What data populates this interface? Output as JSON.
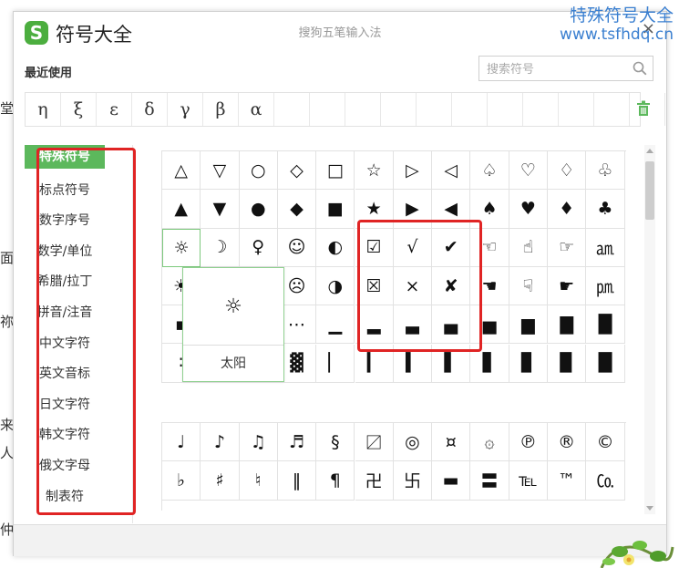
{
  "watermark": {
    "line1": "特殊符号大全",
    "line2": "www.tsfhdq.cn"
  },
  "background_chars": [
    "堂",
    "面",
    "祢",
    "来",
    "人",
    "仲"
  ],
  "window": {
    "logo": "S",
    "title": "符号大全",
    "subtitle": "搜狗五笔输入法",
    "close": "×"
  },
  "recent": {
    "label": "最近使用",
    "items": [
      "η",
      "ξ",
      "ε",
      "δ",
      "γ",
      "β",
      "α",
      "",
      "",
      "",
      "",
      "",
      "",
      "",
      "",
      "",
      "",
      ""
    ]
  },
  "search": {
    "placeholder": "搜索符号",
    "value": ""
  },
  "sidebar": {
    "items": [
      {
        "label": "特殊符号",
        "active": true
      },
      {
        "label": "标点符号"
      },
      {
        "label": "数字序号"
      },
      {
        "label": "数学/单位"
      },
      {
        "label": "希腊/拉丁"
      },
      {
        "label": "拼音/注音"
      },
      {
        "label": "中文字符"
      },
      {
        "label": "英文音标"
      },
      {
        "label": "日文字符"
      },
      {
        "label": "韩文字符"
      },
      {
        "label": "俄文字母"
      },
      {
        "label": "制表符"
      }
    ]
  },
  "grid_main": [
    [
      "△",
      "▽",
      "○",
      "◇",
      "□",
      "☆",
      "▷",
      "◁",
      "♤",
      "♡",
      "♢",
      "♧"
    ],
    [
      "▲",
      "▼",
      "●",
      "◆",
      "■",
      "★",
      "▶",
      "◀",
      "♠",
      "♥",
      "♦",
      "♣"
    ],
    [
      "☼",
      "☽",
      "♀",
      "☺",
      "◐",
      "☑",
      "√",
      "✔",
      "☜",
      "☝",
      "☞",
      "㏂"
    ],
    [
      "☀",
      "☾",
      "♂",
      "☹",
      "◑",
      "☒",
      "×",
      "✘",
      "☚",
      "☟",
      "☛",
      "㏘"
    ],
    [
      "▪",
      "▫",
      "⊙",
      "⋯",
      "▁",
      "▂",
      "▃",
      "▄",
      "▅",
      "▆",
      "▇",
      "█"
    ],
    [
      "∶",
      "░",
      "▒",
      "▓",
      "▏",
      "▎",
      "▍",
      "▌",
      "▋",
      "▊",
      "▉",
      "█"
    ]
  ],
  "grid_second": [
    [
      "♩",
      "♪",
      "♫",
      "♬",
      "§",
      "〼",
      "◎",
      "¤",
      "۞",
      "℗",
      "®",
      "©"
    ],
    [
      "♭",
      "♯",
      "♮",
      "‖",
      "¶",
      "卍",
      "卐",
      "▬",
      "〓",
      "℡",
      "™",
      "㏇"
    ]
  ],
  "popup": {
    "symbol": "☼",
    "name": "太阳"
  },
  "colors": {
    "accent": "#5cb85c",
    "highlight_box": "#e02424",
    "watermark": "#3a7fd0"
  }
}
